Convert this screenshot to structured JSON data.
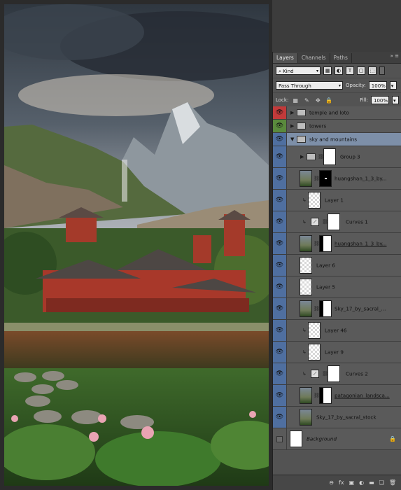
{
  "panel": {
    "tabs": [
      "Layers",
      "Channels",
      "Paths"
    ],
    "tab_controls": "»  ≡",
    "kind_label": "Kind",
    "blend_mode": "Pass Through",
    "opacity_label": "Opacity:",
    "opacity_value": "100%",
    "lock_label": "Lock:",
    "fill_label": "Fill:",
    "fill_value": "100%",
    "filter_icons": [
      "image-filter-icon",
      "adjustment-filter-icon",
      "type-filter-icon",
      "shape-filter-icon",
      "smart-object-filter-icon"
    ],
    "lock_icons": [
      "lock-transparent-icon",
      "lock-image-icon",
      "lock-position-icon",
      "lock-all-icon"
    ]
  },
  "layers": [
    {
      "name": "temple and loto",
      "kind": "group",
      "eye": "red"
    },
    {
      "name": "towers",
      "kind": "group",
      "eye": "green"
    },
    {
      "name": "sky and mountains",
      "kind": "group-open",
      "eye": "blue"
    },
    {
      "name": "Group 3",
      "kind": "subgroup",
      "eye": "blue"
    },
    {
      "name": "huangshan_1_3_by...",
      "kind": "photo-mask",
      "eye": "blue"
    },
    {
      "name": "Layer 1",
      "kind": "trans-clip",
      "eye": "blue"
    },
    {
      "name": "Curves 1",
      "kind": "curves",
      "eye": "blue"
    },
    {
      "name": "huangshan_1_3_by...",
      "kind": "photo-mask2",
      "eye": "blue"
    },
    {
      "name": "Layer 6",
      "kind": "trans",
      "eye": "blue"
    },
    {
      "name": "Layer 5",
      "kind": "trans",
      "eye": "blue"
    },
    {
      "name": "Sky_17_by_sacral_...",
      "kind": "photo-mask3",
      "eye": "blue"
    },
    {
      "name": "Layer 46",
      "kind": "trans-clip",
      "eye": "blue"
    },
    {
      "name": "Layer 9",
      "kind": "trans-clip",
      "eye": "blue"
    },
    {
      "name": "Curves 2",
      "kind": "curves",
      "eye": "blue"
    },
    {
      "name": "patagonian_landsca...",
      "kind": "photo-mask4",
      "eye": "blue"
    },
    {
      "name": "Sky_17_by_sacral_stock",
      "kind": "photo",
      "eye": "blue"
    },
    {
      "name": "Background",
      "kind": "background",
      "eye": "none"
    }
  ],
  "bottom_icons": [
    "link-layers-icon",
    "fx-icon",
    "add-mask-icon",
    "adjustment-layer-icon",
    "new-group-icon",
    "new-layer-icon",
    "trash-icon"
  ],
  "bottom_glyphs": [
    "⊖",
    "fx",
    "▣",
    "◐",
    "▬",
    "❏",
    "🗑"
  ]
}
